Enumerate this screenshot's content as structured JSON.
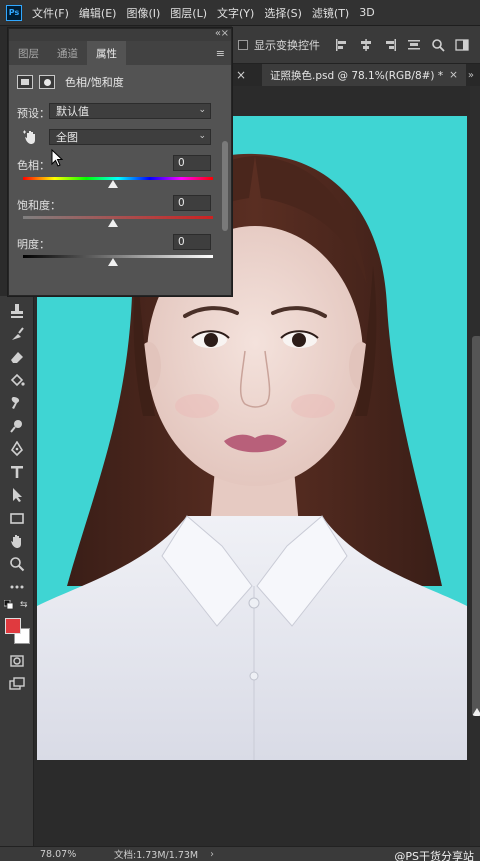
{
  "app": {
    "logo_text": "Ps"
  },
  "menubar": {
    "items": [
      "文件(F)",
      "编辑(E)",
      "图像(I)",
      "图层(L)",
      "文字(Y)",
      "选择(S)",
      "滤镜(T)",
      "3D"
    ]
  },
  "options": {
    "show_transform_label": "显示变换控件",
    "show_transform_checked": false,
    "align_icons": [
      "align-left-icon",
      "align-center-icon",
      "align-right-icon",
      "distribute-icon"
    ],
    "right_icons": [
      "search-icon",
      "workspace-icon"
    ]
  },
  "document_tab": {
    "title": "证照换色.psd @ 78.1%(RGB/8#) *",
    "close": "×"
  },
  "panel": {
    "tabs": [
      "图层",
      "通道",
      "属性"
    ],
    "active_tab": "属性",
    "adjustment_title": "色相/饱和度",
    "preset_label": "预设：",
    "preset_value": "默认值",
    "range_value": "全图",
    "hue_label": "色相：",
    "hue_value": "0",
    "saturation_label": "饱和度：",
    "saturation_value": "0",
    "lightness_label": "明度：",
    "lightness_value": "0"
  },
  "colors": {
    "foreground": "#e03a3f",
    "background": "#ffffff",
    "photo_background": "#3fd5d3"
  },
  "statusbar": {
    "zoom": "78.07%",
    "doc_info": "文档:1.73M/1.73M",
    "arrow": "›"
  },
  "watermark": "@PS干货分享站",
  "toolbar_icons": [
    "stamp-tool-icon",
    "history-brush-icon",
    "eraser-icon",
    "paint-bucket-icon",
    "smudge-icon",
    "dodge-icon",
    "pen-icon",
    "type-tool-icon",
    "path-select-icon",
    "rectangle-icon",
    "hand-icon",
    "zoom-icon",
    "more-tools-icon"
  ]
}
